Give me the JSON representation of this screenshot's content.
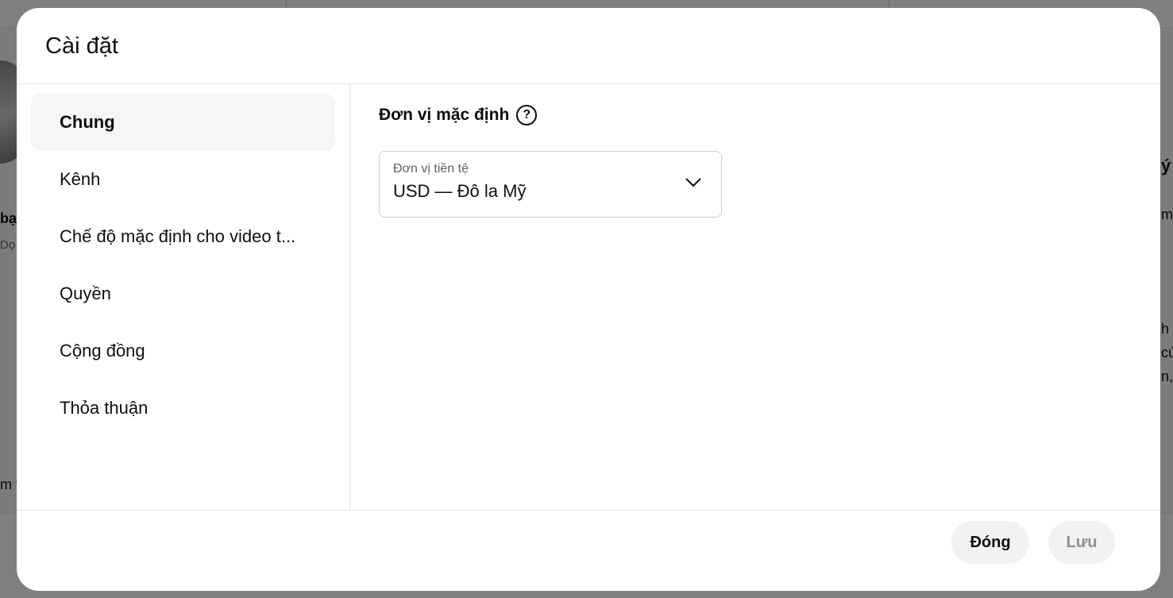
{
  "background": {
    "fragments": [
      "bạ",
      "Dọ",
      "m t",
      "ý",
      "m",
      "h",
      "cú",
      "n,"
    ]
  },
  "dialog": {
    "title": "Cài đặt",
    "nav": [
      {
        "label": "Chung",
        "active": true
      },
      {
        "label": "Kênh",
        "active": false
      },
      {
        "label": "Chế độ mặc định cho video t...",
        "active": false
      },
      {
        "label": "Quyền",
        "active": false
      },
      {
        "label": "Cộng đồng",
        "active": false
      },
      {
        "label": "Thỏa thuận",
        "active": false
      }
    ],
    "section": {
      "heading": "Đơn vị mặc định",
      "help_icon": "question-circle-icon",
      "help_glyph": "?",
      "currency_field": {
        "label": "Đơn vị tiền tệ",
        "value": "USD — Đô la Mỹ",
        "icon": "chevron-down-icon"
      }
    },
    "buttons": {
      "close_label": "Đóng",
      "save_label": "Lưu"
    }
  },
  "colors": {
    "overlay": "#808080",
    "active_nav_bg": "#f6f6f6",
    "button_bg": "#f2f2f2",
    "disabled_text": "#909090"
  }
}
